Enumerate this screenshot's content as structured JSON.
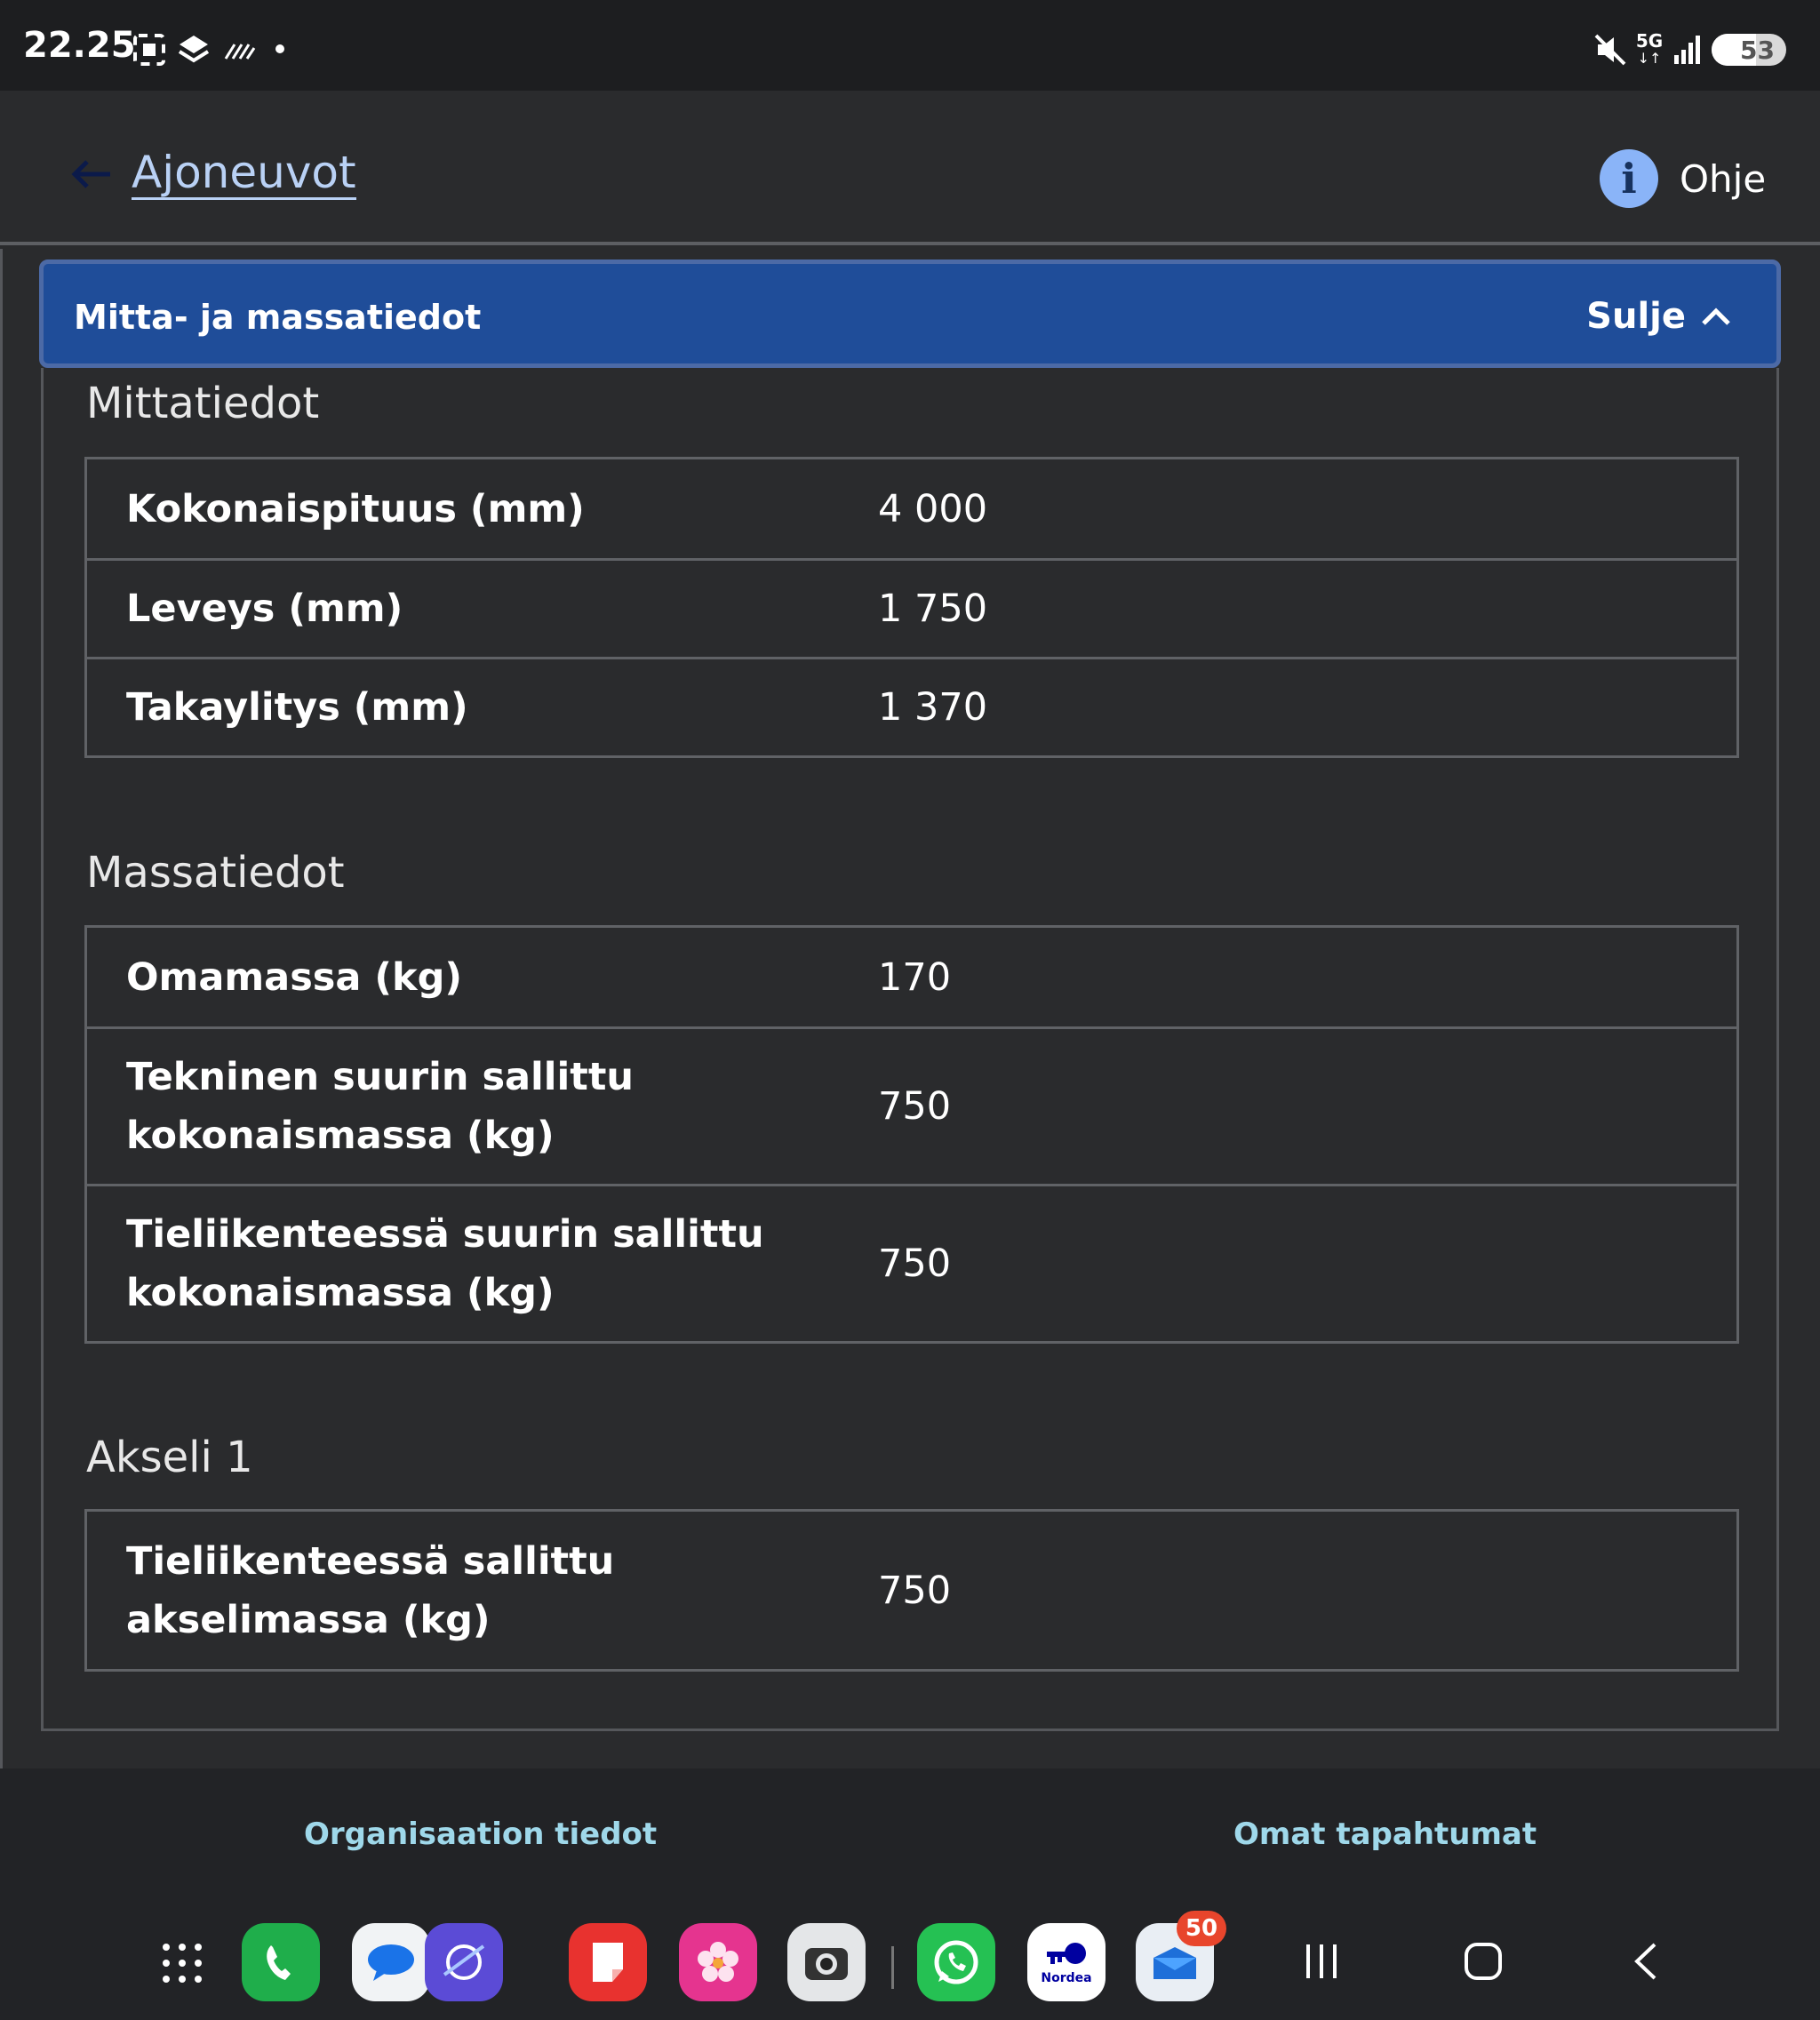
{
  "status_bar": {
    "time": "22.25",
    "network": "5G",
    "battery": "53"
  },
  "app_bar": {
    "back_label": "Ajoneuvot",
    "help_label": "Ohje"
  },
  "accordion": {
    "title": "Mitta- ja massatiedot",
    "close_label": "Sulje"
  },
  "sections": {
    "dimensions": {
      "title": "Mittatiedot",
      "rows": [
        {
          "label": "Kokonaispituus (mm)",
          "value": "4 000"
        },
        {
          "label": "Leveys (mm)",
          "value": "1 750"
        },
        {
          "label": "Takaylitys (mm)",
          "value": "1 370"
        }
      ]
    },
    "mass": {
      "title": "Massatiedot",
      "rows": [
        {
          "label": "Omamassa (kg)",
          "value": "170"
        },
        {
          "label": "Tekninen suurin sallittu kokonaismassa (kg)",
          "value": "750"
        },
        {
          "label": "Tieliikenteessä suurin sallittu kokonaismassa (kg)",
          "value": "750"
        }
      ]
    },
    "axle": {
      "title": "Akseli 1",
      "rows": [
        {
          "label": "Tieliikenteessä sallittu akselimassa (kg)",
          "value": "750"
        }
      ]
    }
  },
  "footer": {
    "org_link": "Organisaation tiedot",
    "events_link": "Omat tapahtumat"
  },
  "dock": {
    "email_badge": "50",
    "nordea_label": "Nordea"
  },
  "colors": {
    "accent": "#1f4d99",
    "link": "#b9d1f5",
    "footer_link": "#9fd8ea",
    "background": "#2a2b2d"
  }
}
